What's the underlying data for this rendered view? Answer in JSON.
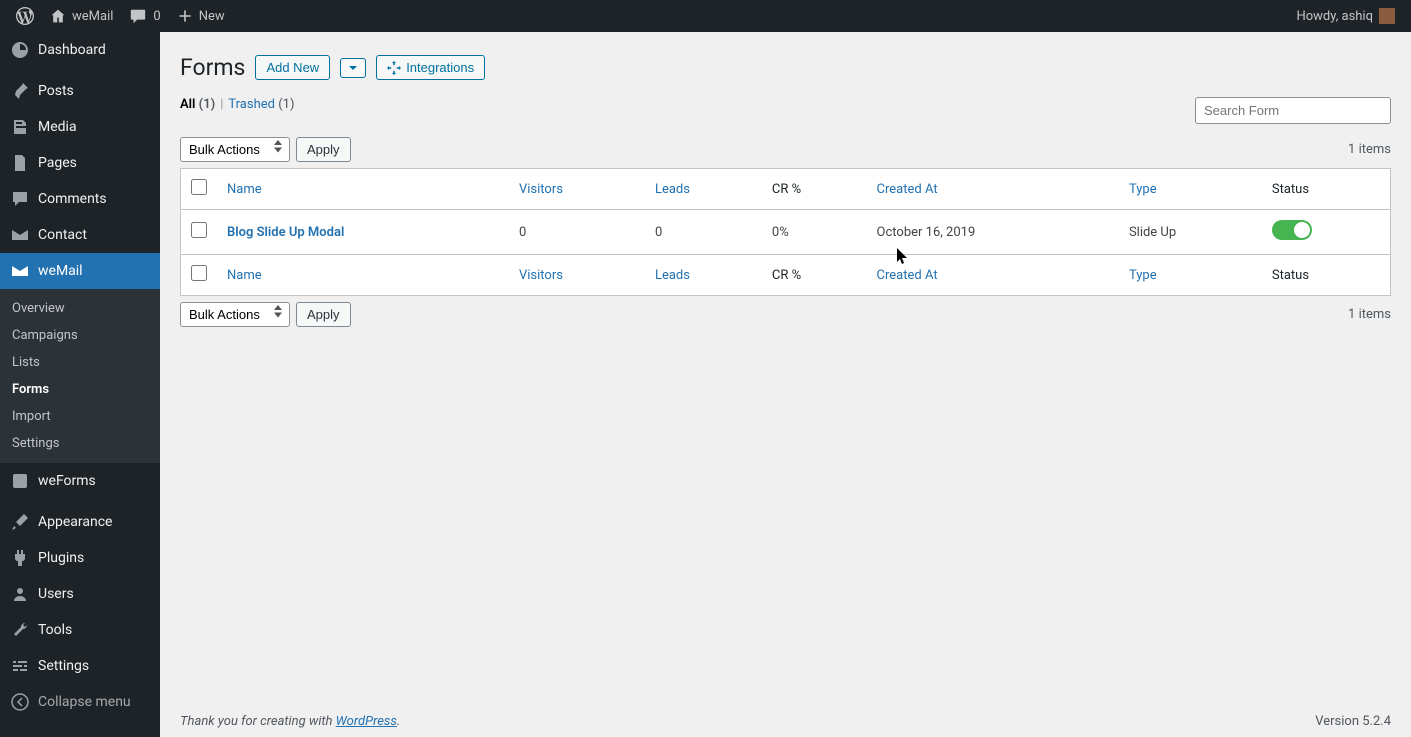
{
  "adminbar": {
    "site_name": "weMail",
    "comments_count": "0",
    "new_label": "New",
    "howdy": "Howdy, ashiq"
  },
  "sidebar": {
    "items": [
      {
        "id": "dashboard",
        "label": "Dashboard"
      },
      {
        "id": "posts",
        "label": "Posts"
      },
      {
        "id": "media",
        "label": "Media"
      },
      {
        "id": "pages",
        "label": "Pages"
      },
      {
        "id": "comments",
        "label": "Comments"
      },
      {
        "id": "contact",
        "label": "Contact"
      },
      {
        "id": "wemail",
        "label": "weMail"
      },
      {
        "id": "weforms",
        "label": "weForms"
      },
      {
        "id": "appearance",
        "label": "Appearance"
      },
      {
        "id": "plugins",
        "label": "Plugins"
      },
      {
        "id": "users",
        "label": "Users"
      },
      {
        "id": "tools",
        "label": "Tools"
      },
      {
        "id": "settings",
        "label": "Settings"
      },
      {
        "id": "collapse",
        "label": "Collapse menu"
      }
    ],
    "wemail_submenu": [
      {
        "id": "overview",
        "label": "Overview"
      },
      {
        "id": "campaigns",
        "label": "Campaigns"
      },
      {
        "id": "lists",
        "label": "Lists"
      },
      {
        "id": "forms",
        "label": "Forms"
      },
      {
        "id": "import",
        "label": "Import"
      },
      {
        "id": "settings",
        "label": "Settings"
      }
    ]
  },
  "page": {
    "title": "Forms",
    "add_new": "Add New",
    "integrations": "Integrations"
  },
  "filters": {
    "all_label": "All",
    "all_count": "(1)",
    "trashed_label": "Trashed",
    "trashed_count": "(1)",
    "search_placeholder": "Search Form"
  },
  "bulk": {
    "label": "Bulk Actions",
    "apply": "Apply"
  },
  "table": {
    "items_count": "1 items",
    "columns": {
      "name": "Name",
      "visitors": "Visitors",
      "leads": "Leads",
      "cr": "CR %",
      "created_at": "Created At",
      "type": "Type",
      "status": "Status"
    },
    "rows": [
      {
        "name": "Blog Slide Up Modal",
        "visitors": "0",
        "leads": "0",
        "cr": "0%",
        "created_at": "October 16, 2019",
        "type": "Slide Up",
        "status_on": true
      }
    ]
  },
  "footer": {
    "thank_you_prefix": "Thank you for creating with ",
    "wordpress": "WordPress",
    "period": ".",
    "version": "Version 5.2.4"
  }
}
